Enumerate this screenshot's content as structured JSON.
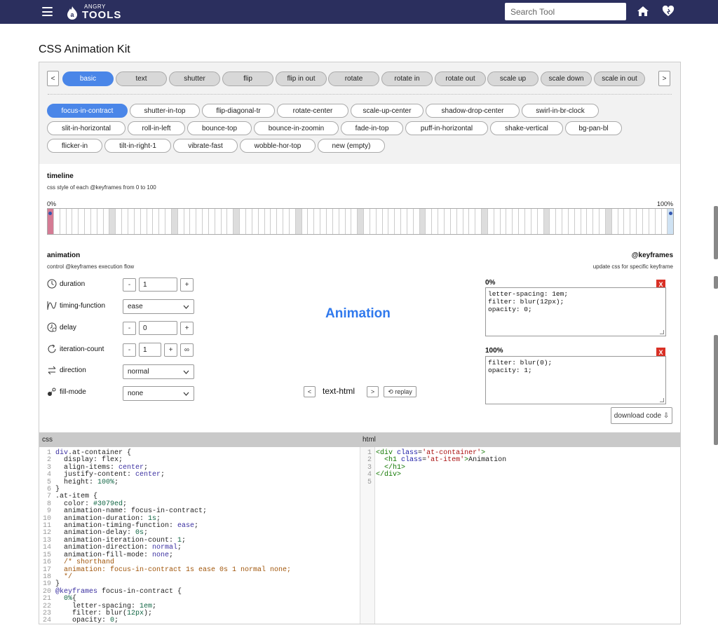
{
  "header": {
    "logo_small": "ANGRY",
    "logo_big": "TOOLS",
    "search_placeholder": "Search Tool"
  },
  "page_title": "CSS Animation Kit",
  "tabs": {
    "prev": "<",
    "next": ">",
    "items": [
      "basic",
      "text",
      "shutter",
      "flip",
      "flip in out",
      "rotate",
      "rotate in",
      "rotate out",
      "scale up",
      "scale down",
      "scale in out"
    ],
    "active": "basic"
  },
  "animations": {
    "rows": [
      [
        "focus-in-contract",
        "shutter-in-top",
        "flip-diagonal-tr",
        "rotate-center",
        "scale-up-center",
        "shadow-drop-center",
        "swirl-in-br-clock"
      ],
      [
        "slit-in-horizontal",
        "roll-in-left",
        "bounce-top",
        "bounce-in-zoomin",
        "fade-in-top",
        "puff-in-horizontal",
        "shake-vertical",
        "bg-pan-bl"
      ],
      [
        "flicker-in",
        "tilt-in-right-1",
        "vibrate-fast",
        "wobble-hor-top",
        "new (empty)"
      ]
    ],
    "active": "focus-in-contract"
  },
  "timeline": {
    "title": "timeline",
    "subtitle": "css style of each @keyframes from 0 to 100",
    "start_label": "0%",
    "end_label": "100%"
  },
  "animation_section": {
    "title": "animation",
    "subtitle": "control @keyframes execution flow",
    "duration_label": "duration",
    "duration_value": "1",
    "timing_label": "timing-function",
    "timing_value": "ease",
    "delay_label": "delay",
    "delay_value": "0",
    "iteration_label": "iteration-count",
    "iteration_value": "1",
    "direction_label": "direction",
    "direction_value": "normal",
    "fill_label": "fill-mode",
    "fill_value": "none",
    "minus": "-",
    "plus": "+",
    "infinity": "∞"
  },
  "preview": {
    "text": "Animation",
    "prev": "<",
    "next": ">",
    "mode": "text-html",
    "replay": "⟲ replay"
  },
  "keyframes_section": {
    "title": "@keyframes",
    "subtitle": "update css for specific keyframe",
    "kf0_label": "0%",
    "kf0_css": "letter-spacing: 1em;\nfilter: blur(12px);\nopacity: 0;",
    "kf100_label": "100%",
    "kf100_css": "filter: blur(0);\nopacity: 1;",
    "remove": "X",
    "download": "download code ⇩"
  },
  "code": {
    "css_label": "css",
    "html_label": "html"
  }
}
